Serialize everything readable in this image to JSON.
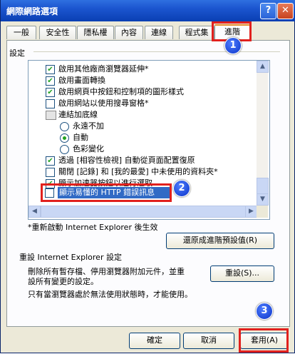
{
  "window": {
    "title": "網際網路選項",
    "help_glyph": "?",
    "close_glyph": "✕"
  },
  "tabs": [
    {
      "label": "一般"
    },
    {
      "label": "安全性"
    },
    {
      "label": "隱私權"
    },
    {
      "label": "內容"
    },
    {
      "label": "連線"
    },
    {
      "label": "程式集"
    },
    {
      "label": "進階"
    }
  ],
  "settings": {
    "group_label": "設定",
    "items": [
      {
        "label": "啟用其他廠商瀏覽器延伸*",
        "type": "checkbox",
        "checked": true
      },
      {
        "label": "啟用畫面轉換",
        "type": "checkbox",
        "checked": true
      },
      {
        "label": "啟用網頁中按鈕和控制項的圖形樣式",
        "type": "checkbox",
        "checked": true
      },
      {
        "label": "啟用網站以使用搜尋窗格*",
        "type": "checkbox",
        "checked": false
      },
      {
        "label": "連結加底線",
        "type": "group",
        "checked": false
      },
      {
        "label": "永遠不加",
        "type": "radio",
        "checked": false
      },
      {
        "label": "自動",
        "type": "radio",
        "checked": true
      },
      {
        "label": "色彩變化",
        "type": "radio",
        "checked": false
      },
      {
        "label": "透過 [相容性檢視] 自動從頁面配置復原",
        "type": "checkbox",
        "checked": true
      },
      {
        "label": "關閉 [記錄] 和 [我的最愛] 中未使用的資料夾*",
        "type": "checkbox",
        "checked": false
      },
      {
        "label": "顯示加速器按鈕以進行選取",
        "type": "checkbox",
        "checked": true
      },
      {
        "label": "顯示易懂的 HTTP 錯誤訊息",
        "type": "checkbox",
        "checked": false
      }
    ],
    "restart_note": "*重新啟動 Internet Explorer 後生效",
    "restore_button": "還原成進階預設值(R)"
  },
  "reset": {
    "title": "重設 Internet Explorer 設定",
    "description_line1": "刪除所有暫存檔、停用瀏覽器附加元件，並重",
    "description_line2": "設所有變更的設定。",
    "note": "只有當瀏覽器處於無法使用狀態時，才能使用。",
    "button": "重設(S)..."
  },
  "footer": {
    "ok": "確定",
    "cancel": "取消",
    "apply": "套用(A)"
  },
  "markers": {
    "m1": "1",
    "m2": "2",
    "m3": "3"
  },
  "colors": {
    "title_bar": "#1b55cf",
    "highlight": "#316ac5",
    "annotation_red": "#e1201d",
    "check_green": "#21a121"
  },
  "icons": {
    "scroll_up": "▲",
    "scroll_down": "▼",
    "scroll_left": "◀",
    "scroll_right": "▶",
    "check": "✔"
  }
}
